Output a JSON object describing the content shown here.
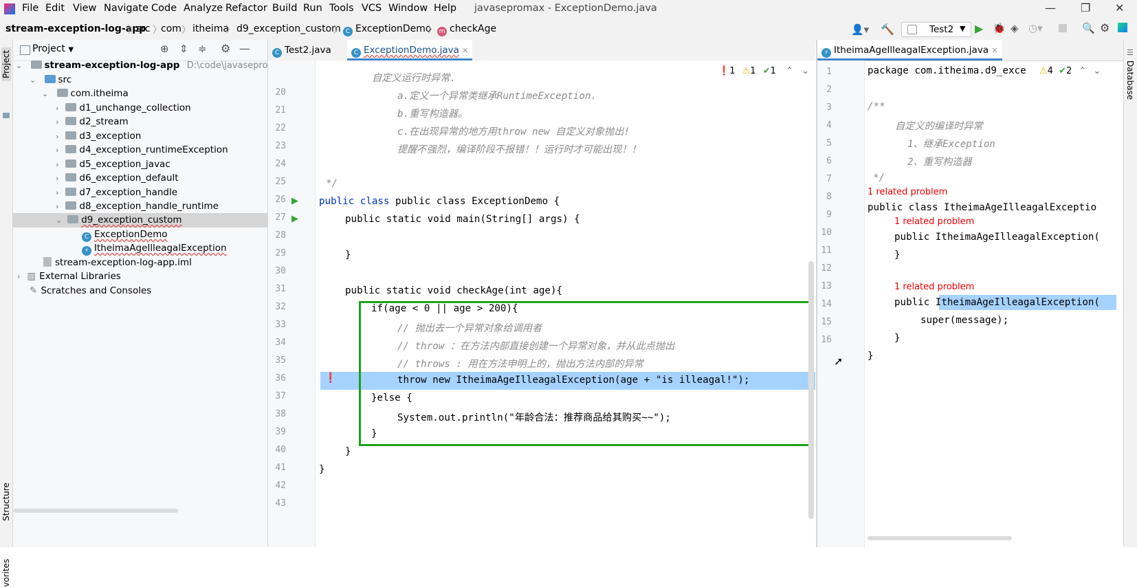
{
  "menubar": {
    "items": [
      "File",
      "Edit",
      "View",
      "Navigate",
      "Code",
      "Analyze",
      "Refactor",
      "Build",
      "Run",
      "Tools",
      "VCS",
      "Window",
      "Help"
    ],
    "title": "javasepromax - ExceptionDemo.java"
  },
  "navbar": {
    "crumbs": [
      "stream-exception-log-app",
      "src",
      "com",
      "itheima",
      "d9_exception_custom",
      "ExceptionDemo",
      "checkAge"
    ],
    "run_config": "Test2"
  },
  "left_strip": {
    "project": "Project",
    "structure": "Structure",
    "favorites": "vorites"
  },
  "right_strip": {
    "database": "Database"
  },
  "project": {
    "header": "Project",
    "tree": [
      {
        "label": "stream-exception-log-app",
        "path": "D:\\code\\javasepromax\\"
      },
      {
        "label": "src"
      },
      {
        "label": "com.itheima"
      },
      {
        "label": "d1_unchange_collection"
      },
      {
        "label": "d2_stream"
      },
      {
        "label": "d3_exception"
      },
      {
        "label": "d4_exception_runtimeException"
      },
      {
        "label": "d5_exception_javac"
      },
      {
        "label": "d6_exception_default"
      },
      {
        "label": "d7_exception_handle"
      },
      {
        "label": "d8_exception_handle_runtime"
      },
      {
        "label": "d9_exception_custom"
      },
      {
        "label": "ExceptionDemo"
      },
      {
        "label": "ItheimaAgeIlleagalException"
      },
      {
        "label": "stream-exception-log-app.iml"
      },
      {
        "label": "External Libraries"
      },
      {
        "label": "Scratches and Consoles"
      }
    ]
  },
  "editor_left": {
    "tabs": [
      "Test2.java",
      "ExceptionDemo.java"
    ],
    "inspections": {
      "errors": "1",
      "warnings": "1",
      "typos": "1"
    },
    "line_numbers": [
      "20",
      "21",
      "22",
      "23",
      "24",
      "25",
      "26",
      "27",
      "28",
      "29",
      "30",
      "31",
      "32",
      "33",
      "34",
      "35",
      "36",
      "37",
      "38",
      "39",
      "40",
      "41",
      "42",
      "43"
    ],
    "lines": [
      "自定义运行时异常.",
      "a.定义一个异常类继承RuntimeException.",
      "b.重写构造器。",
      "c.在出现异常的地方用throw new 自定义对象抛出!",
      "提醒不强烈，编译阶段不报错！！运行时才可能出现！！",
      "",
      "*/",
      "public class ExceptionDemo {",
      "public static void main(String[] args) {",
      "",
      "}",
      "",
      "public static void checkAge(int age){",
      "if(age < 0 || age > 200){",
      "// 抛出去一个异常对象给调用者",
      "// throw ：在方法内部直接创建一个异常对象，并从此点抛出",
      "// throws : 用在方法申明上的，抛出方法内部的异常",
      "throw new ItheimaAgeIlleagalException(age + \"is illeagal!\");",
      "}else {",
      "System.out.println(\"年龄合法：推荐商品给其购买~~\");",
      "}",
      "}",
      "}",
      ""
    ]
  },
  "editor_right": {
    "tab": "ItheimaAgeIlleagalException.java",
    "inspections": {
      "warnings": "4",
      "typos": "2"
    },
    "line_numbers": [
      "1",
      "2",
      "3",
      "4",
      "5",
      "6",
      "7",
      "8",
      "9",
      "10",
      "11",
      "12",
      "13",
      "14",
      "15",
      "16"
    ],
    "hint": "1 related problem",
    "lines": [
      "package com.itheima.d9_exce",
      "",
      "/**",
      "自定义的编译时异常",
      "1、继承Exception",
      "2、重写构造器",
      "*/",
      "public class ItheimaAgeIlleagalExceptio",
      "public ItheimaAgeIlleagalException(",
      "}",
      "",
      "public ItheimaAgeIlleagalException(",
      "super(message);",
      "}",
      "}",
      ""
    ]
  },
  "colors": {
    "accent": "#4083c9",
    "highlight_box": "#1aa31a",
    "selection": "#a6d2ff",
    "keyword": "#0033b3",
    "string": "#067d17",
    "comment": "#8c8c8c",
    "error": "#e00000"
  }
}
